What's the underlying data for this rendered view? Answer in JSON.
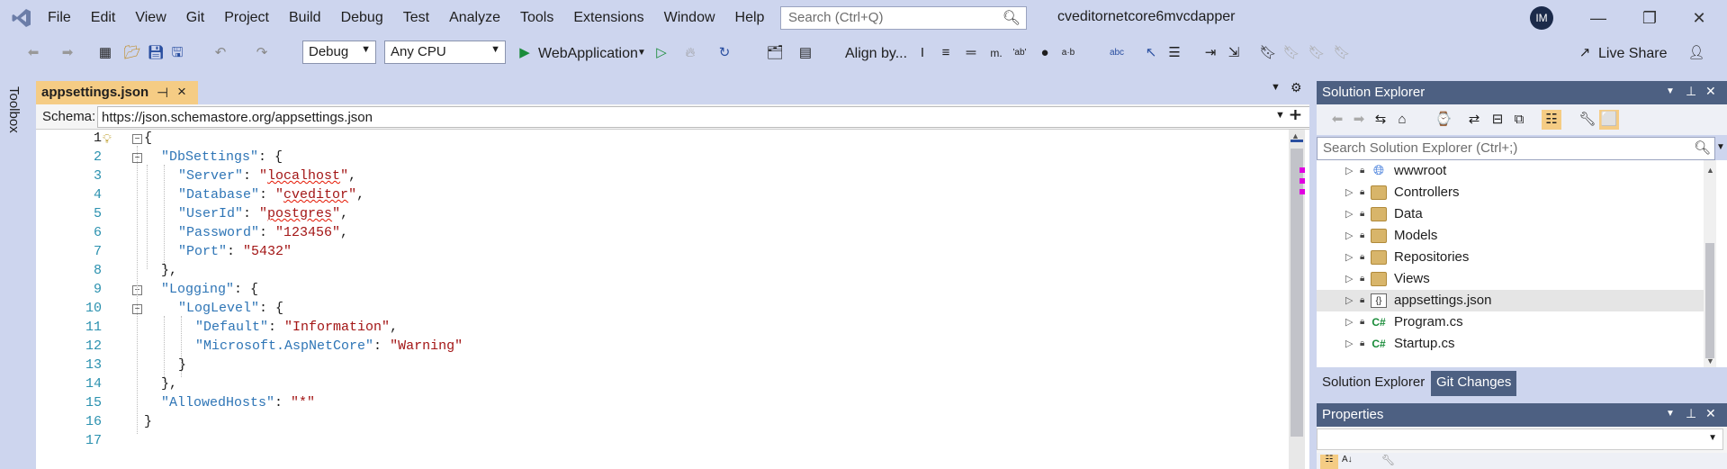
{
  "menu": [
    "File",
    "Edit",
    "View",
    "Git",
    "Project",
    "Build",
    "Debug",
    "Test",
    "Analyze",
    "Tools",
    "Extensions",
    "Window",
    "Help"
  ],
  "search": {
    "placeholder": "Search (Ctrl+Q)"
  },
  "solution_name": "cveditornetcore6mvcdapper",
  "user_initials": "IM",
  "toolbar": {
    "config": "Debug",
    "platform": "Any CPU",
    "run_target": "WebApplication",
    "align_label": "Align by..."
  },
  "toolbox_label": "Toolbox",
  "editor": {
    "tab_title": "appsettings.json",
    "schema_label": "Schema:",
    "schema_url": "https://json.schemastore.org/appsettings.json",
    "lines": [
      {
        "n": "1",
        "text": "{"
      },
      {
        "n": "2",
        "text": "\"DbSettings\": {"
      },
      {
        "n": "3",
        "text": "\"Server\": \"localhost\","
      },
      {
        "n": "4",
        "text": "\"Database\": \"cveditor\","
      },
      {
        "n": "5",
        "text": "\"UserId\": \"postgres\","
      },
      {
        "n": "6",
        "text": "\"Password\": \"123456\","
      },
      {
        "n": "7",
        "text": "\"Port\": \"5432\""
      },
      {
        "n": "8",
        "text": "},"
      },
      {
        "n": "9",
        "text": "\"Logging\": {"
      },
      {
        "n": "10",
        "text": "\"LogLevel\": {"
      },
      {
        "n": "11",
        "text": "\"Default\": \"Information\","
      },
      {
        "n": "12",
        "text": "\"Microsoft.AspNetCore\": \"Warning\""
      },
      {
        "n": "13",
        "text": "}"
      },
      {
        "n": "14",
        "text": "},"
      },
      {
        "n": "15",
        "text": "\"AllowedHosts\": \"*\""
      },
      {
        "n": "16",
        "text": "}"
      },
      {
        "n": "17",
        "text": ""
      }
    ]
  },
  "solution_explorer": {
    "title": "Solution Explorer",
    "search_placeholder": "Search Solution Explorer (Ctrl+;)",
    "items": [
      {
        "name": "wwwroot",
        "icon": "globe-icon"
      },
      {
        "name": "Controllers",
        "icon": "folder-icon"
      },
      {
        "name": "Data",
        "icon": "folder-icon"
      },
      {
        "name": "Models",
        "icon": "folder-icon"
      },
      {
        "name": "Repositories",
        "icon": "folder-icon"
      },
      {
        "name": "Views",
        "icon": "folder-icon"
      },
      {
        "name": "appsettings.json",
        "icon": "json-file-icon",
        "selected": true
      },
      {
        "name": "Program.cs",
        "icon": "csharp-file-icon"
      },
      {
        "name": "Startup.cs",
        "icon": "csharp-file-icon"
      }
    ],
    "tabs": [
      "Solution Explorer",
      "Git Changes"
    ]
  },
  "properties": {
    "title": "Properties"
  },
  "colors": {
    "accent": "#4d6082",
    "tab_active": "#f5cc84",
    "key": "#2e75b6",
    "string": "#a31515",
    "line_number": "#2b91af"
  }
}
